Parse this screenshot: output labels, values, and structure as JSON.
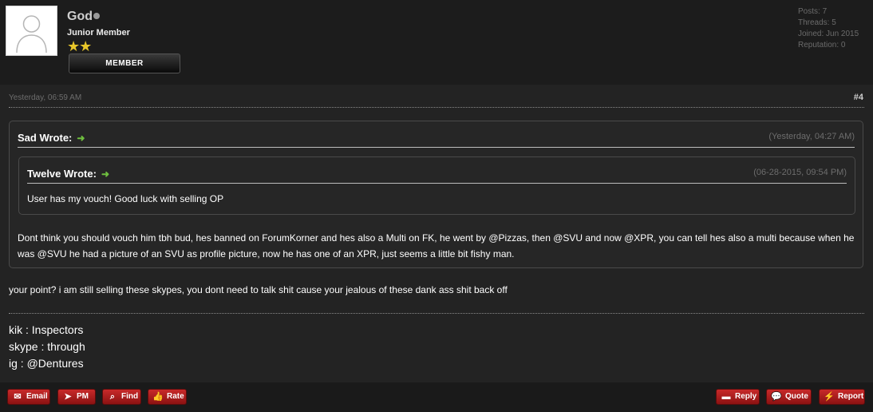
{
  "author": {
    "username": "God",
    "user_title": "Junior Member",
    "stars": "★★",
    "badge": "MEMBER",
    "stats": {
      "posts": "Posts: 7",
      "threads": "Threads: 5",
      "joined": "Joined: Jun 2015",
      "reputation": "Reputation: 0"
    }
  },
  "post": {
    "date": "Yesterday, 06:59 AM",
    "number": "#4",
    "outer_quote": {
      "header": "Sad Wrote:",
      "date": "(Yesterday, 04:27 AM)",
      "text": "Dont think you should vouch him tbh bud, hes banned on ForumKorner and hes also a Multi on FK, he went by @Pizzas, then @SVU and now @XPR, you can tell hes also a multi because when he was @SVU he had a picture of an SVU as profile picture, now he has one of an XPR, just seems a little bit fishy man."
    },
    "inner_quote": {
      "header": "Twelve Wrote:",
      "date": "(06-28-2015, 09:54 PM)",
      "text": "User has my vouch! Good luck with selling OP"
    },
    "body": "your point? i am still selling these skypes, you dont need to talk shit cause your jealous of these dank ass shit back off",
    "signature": [
      "kik : Inspectors",
      "skype : through",
      "ig : @Dentures"
    ]
  },
  "buttons": {
    "email": "Email",
    "pm": "PM",
    "find": "Find",
    "rate": "Rate",
    "reply": "Reply",
    "quote": "Quote",
    "report": "Report"
  },
  "colors": {
    "accent_red": "#b01e1e",
    "quote_arrow": "#6fbf3f",
    "star": "#e8c62a"
  }
}
